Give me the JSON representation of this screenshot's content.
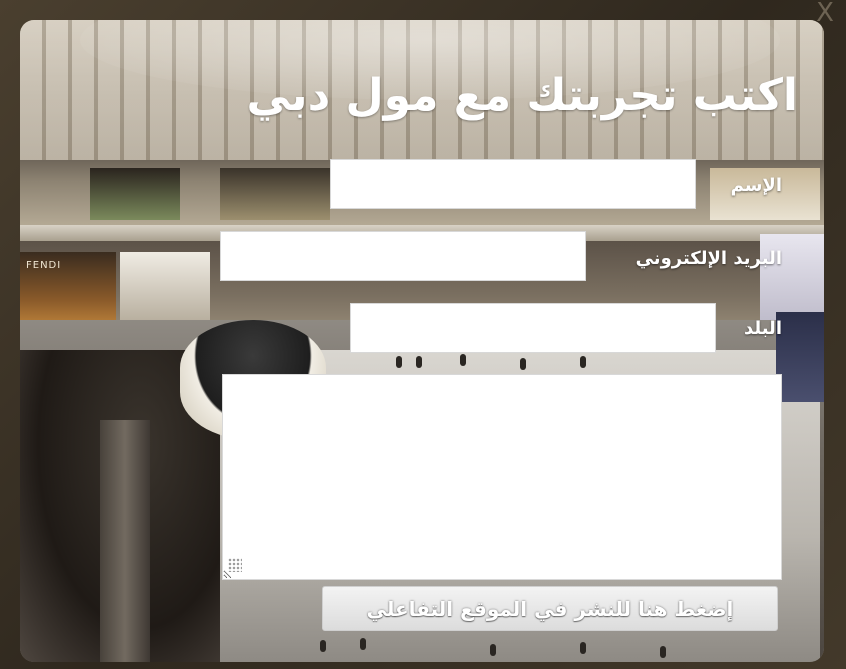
{
  "dialog": {
    "title": "اكتب تجربتك مع مول دبي",
    "close_glyph": "X"
  },
  "background": {
    "store_sign": "FENDI"
  },
  "form": {
    "name_label": "الإسم",
    "name_value": "",
    "email_label": "البريد الإلكتروني",
    "email_value": "",
    "country_label": "البلد",
    "country_value": "",
    "message_value": "",
    "submit_label": "إضغط هنا للنشر في الموقع التفاعلي"
  },
  "colors": {
    "frame": "#3a3226",
    "field_background": "#ffffff",
    "label_text": "#ffffff",
    "button_face": "#e6e6e6"
  }
}
